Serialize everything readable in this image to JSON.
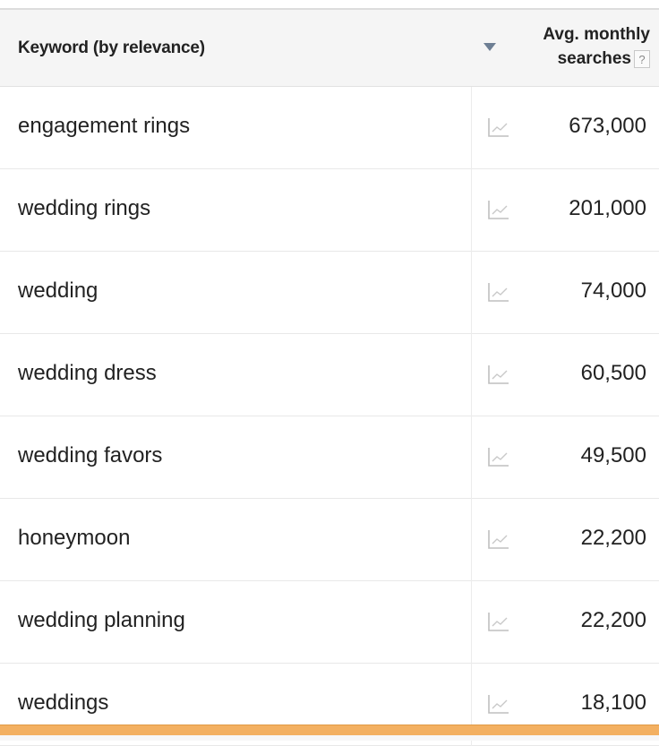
{
  "header": {
    "keyword_label": "Keyword (by relevance)",
    "avg_label_line1": "Avg. monthly",
    "avg_label_line2": "searches",
    "help_glyph": "?",
    "sort_icon": "sort-down-triangle",
    "help_icon": "help-question-icon"
  },
  "rows": [
    {
      "keyword": "engagement rings",
      "searches": "673,000"
    },
    {
      "keyword": "wedding rings",
      "searches": "201,000"
    },
    {
      "keyword": "wedding",
      "searches": "74,000"
    },
    {
      "keyword": "wedding dress",
      "searches": "60,500"
    },
    {
      "keyword": "wedding favors",
      "searches": "49,500"
    },
    {
      "keyword": "honeymoon",
      "searches": "22,200"
    },
    {
      "keyword": "wedding planning",
      "searches": "22,200"
    },
    {
      "keyword": "weddings",
      "searches": "18,100"
    }
  ],
  "icons": {
    "trend": "trend-chart-icon"
  },
  "colors": {
    "header_bg": "#f5f5f5",
    "sort_arrow": "#6e7f94",
    "footer_accent": "#f3b061",
    "trend_icon": "#bfbfbf"
  }
}
